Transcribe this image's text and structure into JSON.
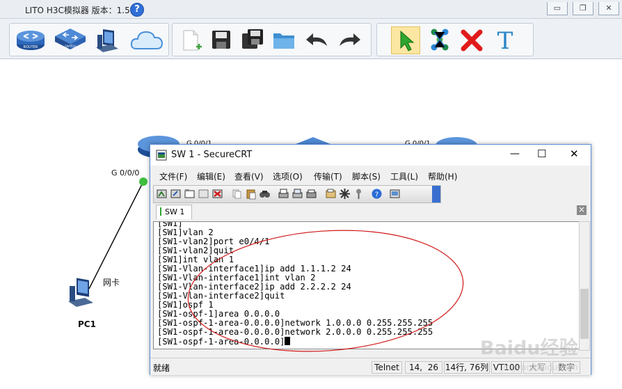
{
  "app": {
    "title": "LITO H3C模拟器 版本：1.5.2",
    "help_icon": "?",
    "window_buttons": [
      "▭",
      "❐",
      "✕"
    ]
  },
  "toolbar": {
    "items": [
      "router",
      "switch",
      "pc",
      "cloud",
      "new-file",
      "save",
      "save-as",
      "open-folder",
      "undo",
      "redo",
      "select-pointer",
      "connect",
      "delete",
      "text"
    ],
    "router_label": "ROUTER",
    "switch_label": "SWITCH",
    "text_tool": "T"
  },
  "topology": {
    "pc_name": "PC1",
    "pc_link_label": "网卡",
    "router_port": "G 0/0/0",
    "router_top_port": "G 0/0/1",
    "right_router_port": "G 0/0/1"
  },
  "crt": {
    "title": "SW 1 - SecureCRT",
    "controls": [
      "—",
      "☐",
      "✕"
    ],
    "menu": [
      "文件(F)",
      "编辑(E)",
      "查看(V)",
      "选项(O)",
      "传输(T)",
      "脚本(S)",
      "工具(L)",
      "帮助(H)"
    ],
    "toolbar_icons": [
      "connect-icon",
      "quick-connect-icon",
      "tab-connect-icon",
      "reconnect-icon",
      "disconnect-icon",
      "copy-icon",
      "paste-icon",
      "find-icon",
      "print-icon",
      "print-selection-icon",
      "printer-setup-icon",
      "session-options-icon",
      "global-options-icon",
      "keymap-icon",
      "help-icon",
      "sftp-icon"
    ],
    "tab_label": "SW 1",
    "tab_close": "×",
    "terminal_lines": [
      "[SW1]",
      "[SW1]vlan 2",
      "[SW1-vlan2]port e0/4/1",
      "[SW1-vlan2]quit",
      "[SW1]int vlan 1",
      "[SW1-Vlan-interface1]ip add 1.1.1.2 24",
      "[SW1-Vlan-interface1]int vlan 2",
      "[SW1-Vlan-interface2]ip add 2.2.2.2 24",
      "[SW1-Vlan-interface2]quit",
      "[SW1]ospf 1",
      "[SW1-ospf-1]area 0.0.0.0",
      "[SW1-ospf-1-area-0.0.0.0]network 1.0.0.0 0.255.255.255",
      "[SW1-ospf-1-area-0.0.0.0]network 2.0.0.0 0.255.255.255",
      "[SW1-ospf-1-area-0.0.0.0]"
    ],
    "status": {
      "ready": "就绪",
      "protocol": "Telnet",
      "cursor_pos": "14,  26",
      "rows_cols": "14行, 76列",
      "terminal_type": "VT100",
      "caps": "大写",
      "numlock": "数字"
    }
  },
  "annotation": {
    "color": "#d01818"
  },
  "watermark": {
    "text": "Baidu经验",
    "subtext": "jingyan.baidu.com"
  }
}
